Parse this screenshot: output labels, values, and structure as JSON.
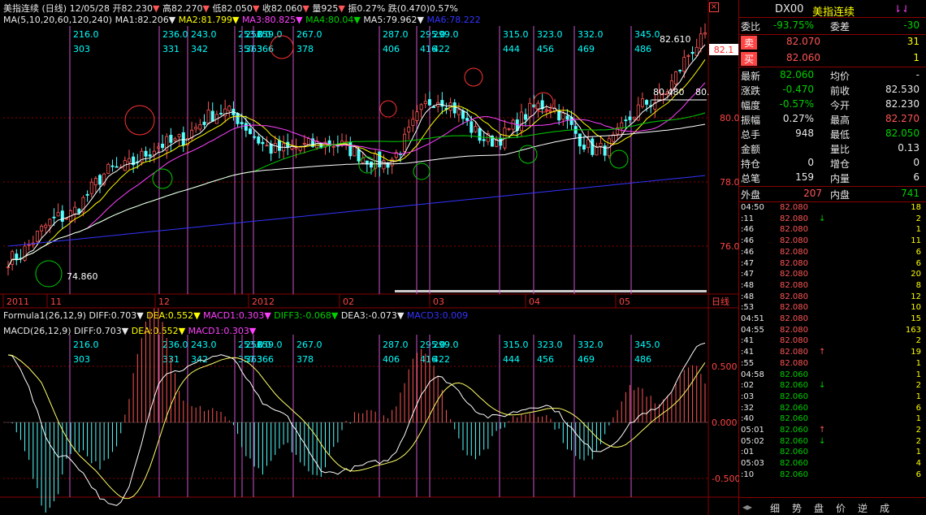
{
  "main_header": {
    "title": "美指连续",
    "period": "(日线)",
    "date": "12/05/28",
    "open": "开82.230",
    "high": "高82.270",
    "low": "低82.050",
    "close": "收82.060",
    "volume": "量925",
    "amplitude": "振0.27%",
    "change": "跌(0.470)0.57%"
  },
  "ma_header": {
    "label": "MA(5,10,20,60,120,240)",
    "ma1": "MA1:82.206",
    "ma2": "MA2:81.799",
    "ma3": "MA3:80.825",
    "ma4": "MA4:80.04",
    "ma5": "MA5:79.962",
    "ma6": "MA6:78.222"
  },
  "formula_header": {
    "label": "Formula1(26,12,9)",
    "diff": "DIFF:0.703",
    "dea": "DEA:0.552",
    "macd1": "MACD1:0.303",
    "diff3": "DIFF3:-0.068",
    "dea3": "DEA3:-0.073",
    "macd3": "MACD3:0.009"
  },
  "macd_header": {
    "label": "MACD(26,12,9)",
    "diff": "DIFF:0.703",
    "dea": "DEA:0.552",
    "macd1": "MACD1:0.303"
  },
  "date_axis": [
    "2011",
    "11",
    "12",
    "2012",
    "02",
    "03",
    "04",
    "05"
  ],
  "date_axis_suffix": "日线",
  "cycle_lines": [
    {
      "top": "216.0",
      "bottom": "303"
    },
    {
      "top": "236.0",
      "bottom": "331"
    },
    {
      "top": "243.0",
      "bottom": "342"
    },
    {
      "top": "253.0",
      "bottom": "357"
    },
    {
      "top": "256.0",
      "bottom": "363"
    },
    {
      "top": "259.0",
      "bottom": "366"
    },
    {
      "top": "267.0",
      "bottom": "378"
    },
    {
      "top": "287.0",
      "bottom": "406"
    },
    {
      "top": "295.0",
      "bottom": "416"
    },
    {
      "top": "299.0",
      "bottom": "422"
    },
    {
      "top": "315.0",
      "bottom": "444"
    },
    {
      "top": "323.0",
      "bottom": "456"
    },
    {
      "top": "332.0",
      "bottom": "469"
    },
    {
      "top": "345.0",
      "bottom": "486"
    }
  ],
  "chart_data": [
    {
      "type": "line",
      "name": "price",
      "y_ticks": [
        "80.0",
        "78.0",
        "76.0"
      ],
      "current_price_tag": "82.1",
      "annotations": [
        "74.860",
        "82.610",
        "80.480",
        "80."
      ],
      "x_dates": [
        "2011/10",
        "2011/11",
        "2011/12",
        "2012/01",
        "2012/02",
        "2012/03",
        "2012/04",
        "2012/05"
      ],
      "close": [
        75.6,
        76.9,
        78.4,
        79.2,
        80.2,
        79.0,
        79.2,
        78.6,
        80.6,
        79.3,
        80.4,
        79.0,
        80.5,
        82.4
      ]
    },
    {
      "type": "line",
      "name": "macd",
      "y_ticks": [
        "0.500",
        "0.000",
        "-0.500"
      ],
      "x_dates": [
        "2011/10",
        "2011/11",
        "2011/12",
        "2012/01",
        "2012/02",
        "2012/03",
        "2012/04",
        "2012/05"
      ],
      "series": [
        {
          "name": "DIFF",
          "values": [
            0.6,
            -0.3,
            -0.75,
            0.45,
            0.6,
            0.1,
            -0.45,
            -0.35,
            0.4,
            0.05,
            0.15,
            -0.25,
            0.1,
            0.7
          ]
        },
        {
          "name": "DEA",
          "values": [
            0.4,
            0.0,
            -0.5,
            0.2,
            0.55,
            0.25,
            -0.2,
            -0.3,
            0.2,
            0.1,
            0.1,
            -0.15,
            0.0,
            0.55
          ]
        }
      ]
    }
  ],
  "quote_panel": {
    "code": "DX00",
    "name": "美指连续",
    "weibi_label": "委比",
    "weibi": "-93.75%",
    "weicha_label": "委差",
    "weicha": "-30",
    "sell_label": "卖",
    "sell_price": "82.070",
    "sell_vol": "31",
    "buy_label": "买",
    "buy_price": "82.060",
    "buy_vol": "1",
    "rows": [
      {
        "l1": "最新",
        "v1": "82.060",
        "l2": "均价",
        "v2": "-"
      },
      {
        "l1": "涨跌",
        "v1": "-0.470",
        "l2": "前收",
        "v2": "82.530"
      },
      {
        "l1": "幅度",
        "v1": "-0.57%",
        "l2": "今开",
        "v2": "82.230"
      },
      {
        "l1": "振幅",
        "v1": "0.27%",
        "l2": "最高",
        "v2": "82.270"
      },
      {
        "l1": "总手",
        "v1": "948",
        "l2": "最低",
        "v2": "82.050"
      },
      {
        "l1": "金额",
        "v1": "",
        "l2": "量比",
        "v2": "0.13"
      },
      {
        "l1": "持仓",
        "v1": "0",
        "l2": "增仓",
        "v2": "0"
      },
      {
        "l1": "总笔",
        "v1": "159",
        "l2": "内量",
        "v2": "6"
      }
    ],
    "outer_label": "外盘",
    "outer": "207",
    "inner_label": "内盘",
    "inner": "741"
  },
  "ticks": [
    {
      "t": "04:50",
      "p": "82.080",
      "a": "",
      "v": "18"
    },
    {
      "t": ":11",
      "p": "82.080",
      "a": "↓",
      "v": "2"
    },
    {
      "t": ":46",
      "p": "82.080",
      "a": "",
      "v": "1"
    },
    {
      "t": ":46",
      "p": "82.080",
      "a": "",
      "v": "11"
    },
    {
      "t": ":46",
      "p": "82.080",
      "a": "",
      "v": "6"
    },
    {
      "t": ":47",
      "p": "82.080",
      "a": "",
      "v": "6"
    },
    {
      "t": ":47",
      "p": "82.080",
      "a": "",
      "v": "20"
    },
    {
      "t": ":48",
      "p": "82.080",
      "a": "",
      "v": "8"
    },
    {
      "t": ":48",
      "p": "82.080",
      "a": "",
      "v": "12"
    },
    {
      "t": ":53",
      "p": "82.080",
      "a": "",
      "v": "10"
    },
    {
      "t": "04:51",
      "p": "82.080",
      "a": "",
      "v": "15"
    },
    {
      "t": "04:55",
      "p": "82.080",
      "a": "",
      "v": "163"
    },
    {
      "t": ":41",
      "p": "82.080",
      "a": "",
      "v": "2"
    },
    {
      "t": ":41",
      "p": "82.080",
      "a": "↑",
      "v": "19"
    },
    {
      "t": ":55",
      "p": "82.080",
      "a": "",
      "v": "1"
    },
    {
      "t": "04:58",
      "p": "82.060",
      "a": "",
      "v": "1"
    },
    {
      "t": ":02",
      "p": "82.060",
      "a": "↓",
      "v": "2"
    },
    {
      "t": ":03",
      "p": "82.060",
      "a": "",
      "v": "1"
    },
    {
      "t": ":32",
      "p": "82.060",
      "a": "",
      "v": "6"
    },
    {
      "t": ":40",
      "p": "82.060",
      "a": "",
      "v": "1"
    },
    {
      "t": "05:01",
      "p": "82.060",
      "a": "↑",
      "v": "2"
    },
    {
      "t": "05:02",
      "p": "82.060",
      "a": "↓",
      "v": "2"
    },
    {
      "t": ":01",
      "p": "82.060",
      "a": "",
      "v": "1"
    },
    {
      "t": "05:03",
      "p": "82.060",
      "a": "",
      "v": "4"
    },
    {
      "t": ":10",
      "p": "82.060",
      "a": "",
      "v": "6"
    }
  ],
  "tabs": [
    "细",
    "势",
    "盘",
    "价",
    "逆",
    "成"
  ],
  "colors": {
    "ma1": "#ffffff",
    "ma2": "#ffff00",
    "ma3": "#ff40ff",
    "ma4": "#00d000",
    "ma5": "#ffffff",
    "ma6": "#3333ff",
    "up": "#ff5555",
    "down": "#55ffff",
    "cycle": "#cc55cc",
    "grid": "#8b0000"
  }
}
